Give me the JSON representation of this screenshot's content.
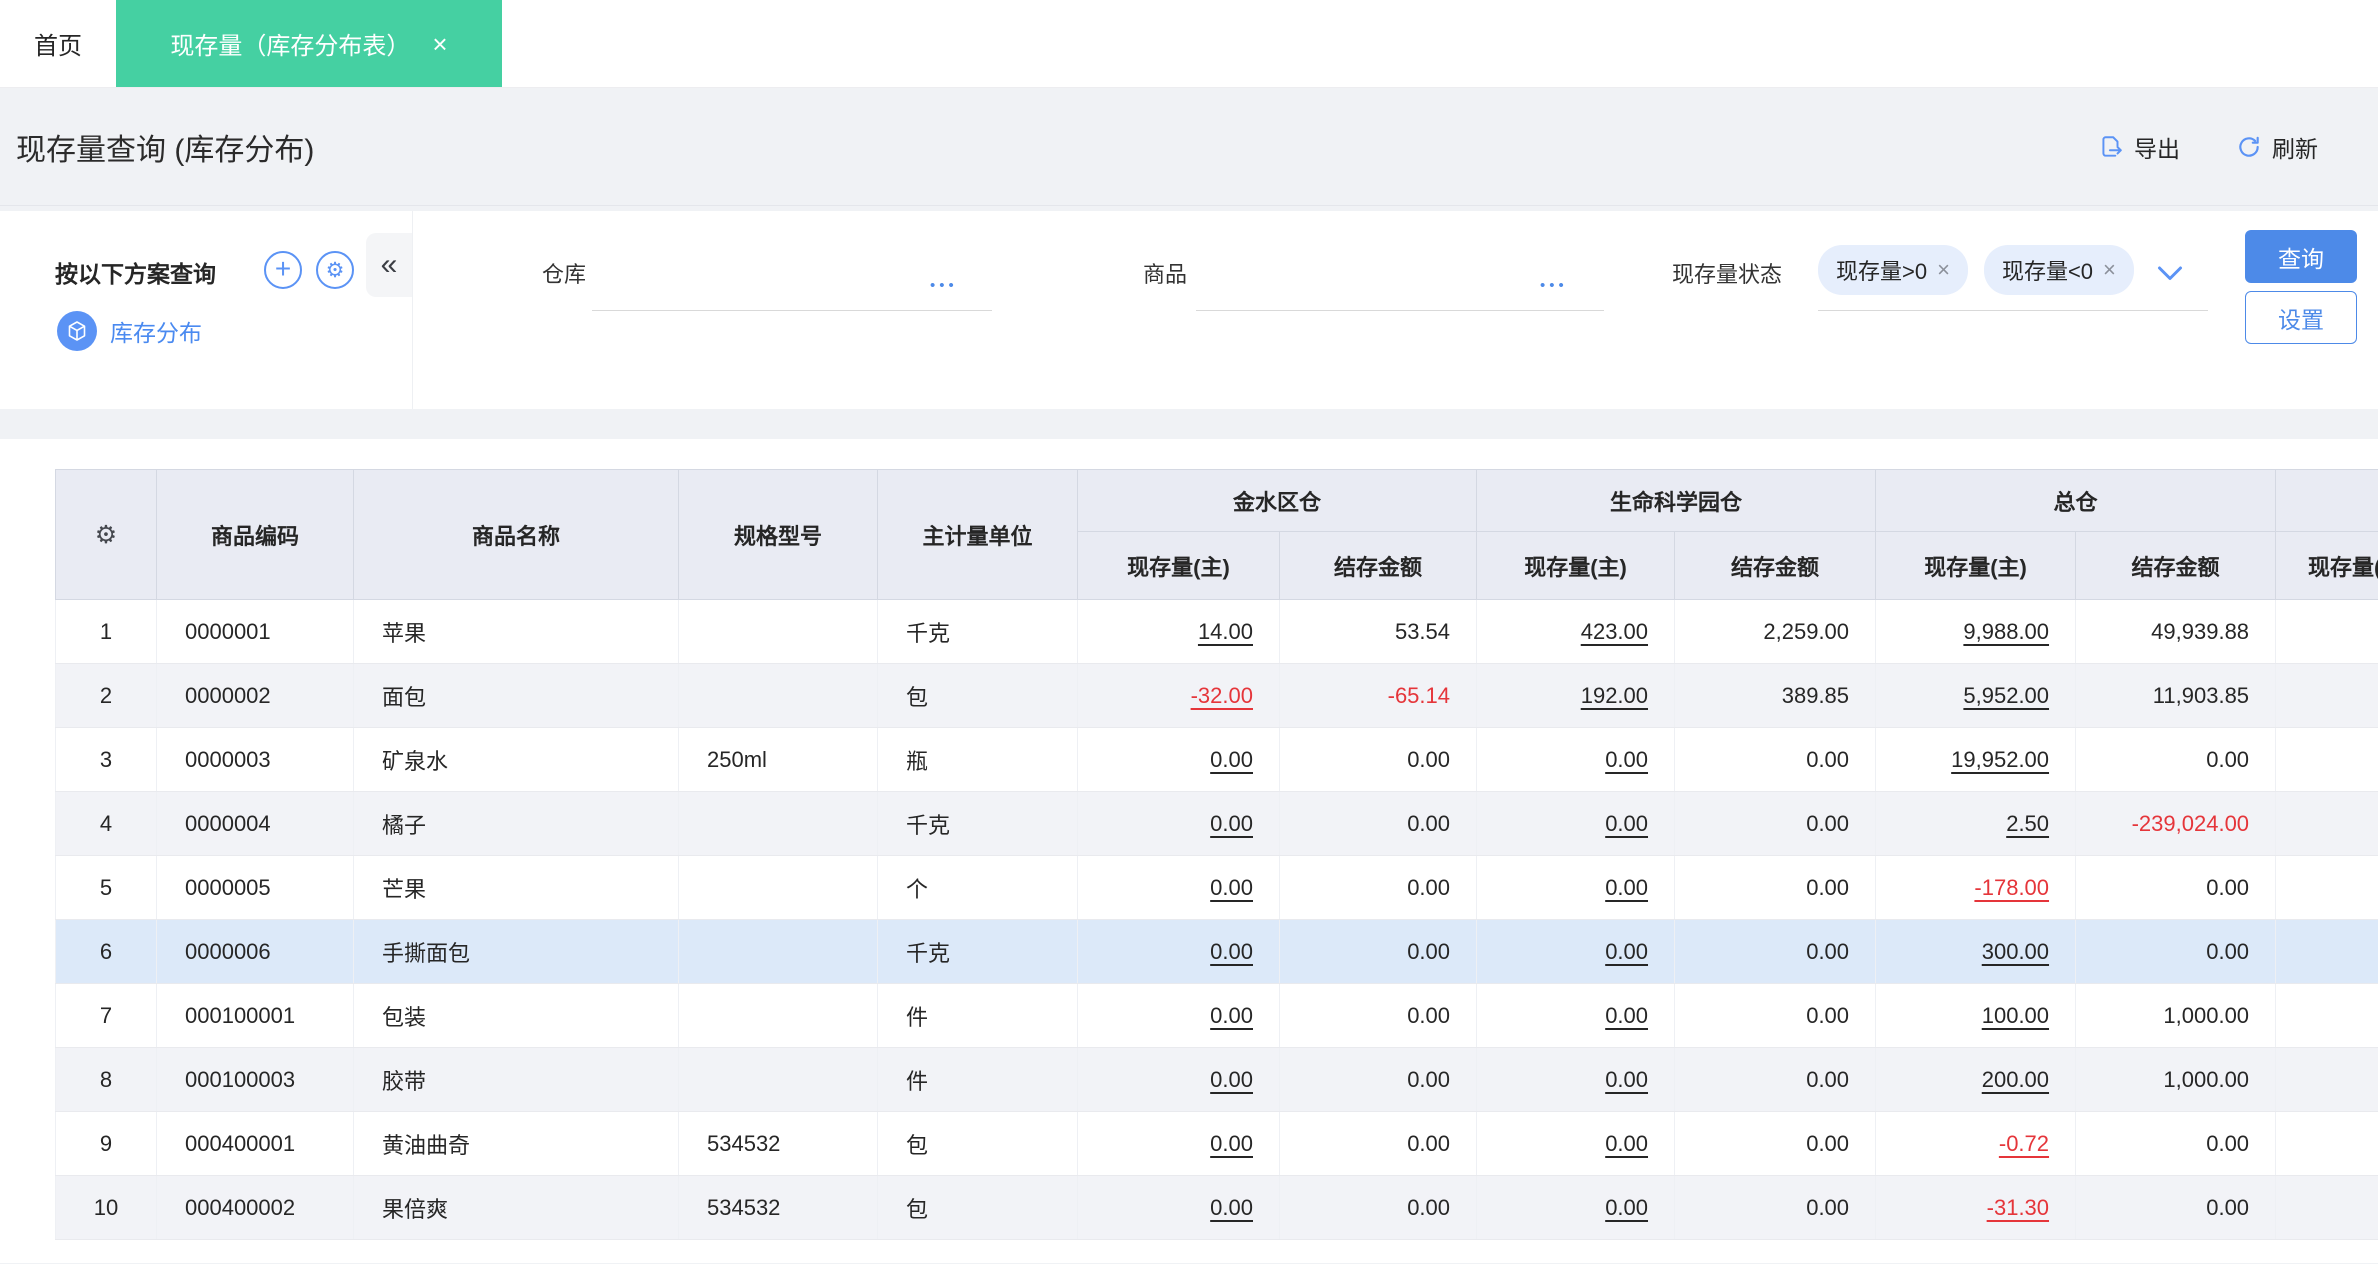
{
  "icons": {
    "close": "×",
    "collapse": "«",
    "plus": "+",
    "gear": "⚙",
    "more": "•••",
    "corner_gear": "⚙"
  },
  "colors": {
    "tab_green": "#45d0a2",
    "accent_blue": "#4d8ae8",
    "link_blue": "#4a8af0",
    "negative_red": "#e5353a"
  },
  "tabs": {
    "home": "首页",
    "active": "现存量（库存分布表）"
  },
  "header": {
    "title": "现存量查询 (库存分布)",
    "export_label": "导出",
    "refresh_label": "刷新"
  },
  "filter": {
    "panel_title": "按以下方案查询",
    "scheme_label": "库存分布",
    "warehouse_label": "仓库",
    "product_label": "商品",
    "status_label": "现存量状态",
    "tags": [
      {
        "label": "现存量>0"
      },
      {
        "label": "现存量<0"
      }
    ],
    "query_button": "查询",
    "settings_button": "设置"
  },
  "table": {
    "simple_headers": [
      "商品编码",
      "商品名称",
      "规格型号",
      "主计量单位"
    ],
    "warehouse_groups": [
      "金水区仓",
      "生命科学园仓",
      "总仓"
    ],
    "measure_headers": [
      "现存量(主)",
      "结存金额"
    ],
    "partial_column_header": "现存量(主)",
    "rows": [
      {
        "no": "1",
        "code": "0000001",
        "name": "苹果",
        "spec": "",
        "unit": "千克",
        "selected": false,
        "values": [
          {
            "v": "14.00",
            "link": true,
            "neg": false
          },
          {
            "v": "53.54",
            "link": false,
            "neg": false
          },
          {
            "v": "423.00",
            "link": true,
            "neg": false
          },
          {
            "v": "2,259.00",
            "link": false,
            "neg": false
          },
          {
            "v": "9,988.00",
            "link": true,
            "neg": false
          },
          {
            "v": "49,939.88",
            "link": false,
            "neg": false
          }
        ]
      },
      {
        "no": "2",
        "code": "0000002",
        "name": "面包",
        "spec": "",
        "unit": "包",
        "selected": false,
        "values": [
          {
            "v": "-32.00",
            "link": true,
            "neg": true
          },
          {
            "v": "-65.14",
            "link": false,
            "neg": true
          },
          {
            "v": "192.00",
            "link": true,
            "neg": false
          },
          {
            "v": "389.85",
            "link": false,
            "neg": false
          },
          {
            "v": "5,952.00",
            "link": true,
            "neg": false
          },
          {
            "v": "11,903.85",
            "link": false,
            "neg": false
          }
        ]
      },
      {
        "no": "3",
        "code": "0000003",
        "name": "矿泉水",
        "spec": "250ml",
        "unit": "瓶",
        "selected": false,
        "values": [
          {
            "v": "0.00",
            "link": true,
            "neg": false
          },
          {
            "v": "0.00",
            "link": false,
            "neg": false
          },
          {
            "v": "0.00",
            "link": true,
            "neg": false
          },
          {
            "v": "0.00",
            "link": false,
            "neg": false
          },
          {
            "v": "19,952.00",
            "link": true,
            "neg": false
          },
          {
            "v": "0.00",
            "link": false,
            "neg": false
          }
        ]
      },
      {
        "no": "4",
        "code": "0000004",
        "name": "橘子",
        "spec": "",
        "unit": "千克",
        "selected": false,
        "values": [
          {
            "v": "0.00",
            "link": true,
            "neg": false
          },
          {
            "v": "0.00",
            "link": false,
            "neg": false
          },
          {
            "v": "0.00",
            "link": true,
            "neg": false
          },
          {
            "v": "0.00",
            "link": false,
            "neg": false
          },
          {
            "v": "2.50",
            "link": true,
            "neg": false
          },
          {
            "v": "-239,024.00",
            "link": false,
            "neg": true
          }
        ]
      },
      {
        "no": "5",
        "code": "0000005",
        "name": "芒果",
        "spec": "",
        "unit": "个",
        "selected": false,
        "values": [
          {
            "v": "0.00",
            "link": true,
            "neg": false
          },
          {
            "v": "0.00",
            "link": false,
            "neg": false
          },
          {
            "v": "0.00",
            "link": true,
            "neg": false
          },
          {
            "v": "0.00",
            "link": false,
            "neg": false
          },
          {
            "v": "-178.00",
            "link": true,
            "neg": true
          },
          {
            "v": "0.00",
            "link": false,
            "neg": false
          }
        ]
      },
      {
        "no": "6",
        "code": "0000006",
        "name": "手撕面包",
        "spec": "",
        "unit": "千克",
        "selected": true,
        "values": [
          {
            "v": "0.00",
            "link": true,
            "neg": false
          },
          {
            "v": "0.00",
            "link": false,
            "neg": false
          },
          {
            "v": "0.00",
            "link": true,
            "neg": false
          },
          {
            "v": "0.00",
            "link": false,
            "neg": false
          },
          {
            "v": "300.00",
            "link": true,
            "neg": false
          },
          {
            "v": "0.00",
            "link": false,
            "neg": false
          }
        ]
      },
      {
        "no": "7",
        "code": "000100001",
        "name": "包装",
        "spec": "",
        "unit": "件",
        "selected": false,
        "values": [
          {
            "v": "0.00",
            "link": true,
            "neg": false
          },
          {
            "v": "0.00",
            "link": false,
            "neg": false
          },
          {
            "v": "0.00",
            "link": true,
            "neg": false
          },
          {
            "v": "0.00",
            "link": false,
            "neg": false
          },
          {
            "v": "100.00",
            "link": true,
            "neg": false
          },
          {
            "v": "1,000.00",
            "link": false,
            "neg": false
          }
        ]
      },
      {
        "no": "8",
        "code": "000100003",
        "name": "胶带",
        "spec": "",
        "unit": "件",
        "selected": false,
        "values": [
          {
            "v": "0.00",
            "link": true,
            "neg": false
          },
          {
            "v": "0.00",
            "link": false,
            "neg": false
          },
          {
            "v": "0.00",
            "link": true,
            "neg": false
          },
          {
            "v": "0.00",
            "link": false,
            "neg": false
          },
          {
            "v": "200.00",
            "link": true,
            "neg": false
          },
          {
            "v": "1,000.00",
            "link": false,
            "neg": false
          }
        ]
      },
      {
        "no": "9",
        "code": "000400001",
        "name": "黄油曲奇",
        "spec": "534532",
        "unit": "包",
        "selected": false,
        "values": [
          {
            "v": "0.00",
            "link": true,
            "neg": false
          },
          {
            "v": "0.00",
            "link": false,
            "neg": false
          },
          {
            "v": "0.00",
            "link": true,
            "neg": false
          },
          {
            "v": "0.00",
            "link": false,
            "neg": false
          },
          {
            "v": "-0.72",
            "link": true,
            "neg": true
          },
          {
            "v": "0.00",
            "link": false,
            "neg": false
          }
        ]
      },
      {
        "no": "10",
        "code": "000400002",
        "name": "果倍爽",
        "spec": "534532",
        "unit": "包",
        "selected": false,
        "values": [
          {
            "v": "0.00",
            "link": true,
            "neg": false
          },
          {
            "v": "0.00",
            "link": false,
            "neg": false
          },
          {
            "v": "0.00",
            "link": true,
            "neg": false
          },
          {
            "v": "0.00",
            "link": false,
            "neg": false
          },
          {
            "v": "-31.30",
            "link": true,
            "neg": true
          },
          {
            "v": "0.00",
            "link": false,
            "neg": false
          }
        ]
      }
    ]
  }
}
